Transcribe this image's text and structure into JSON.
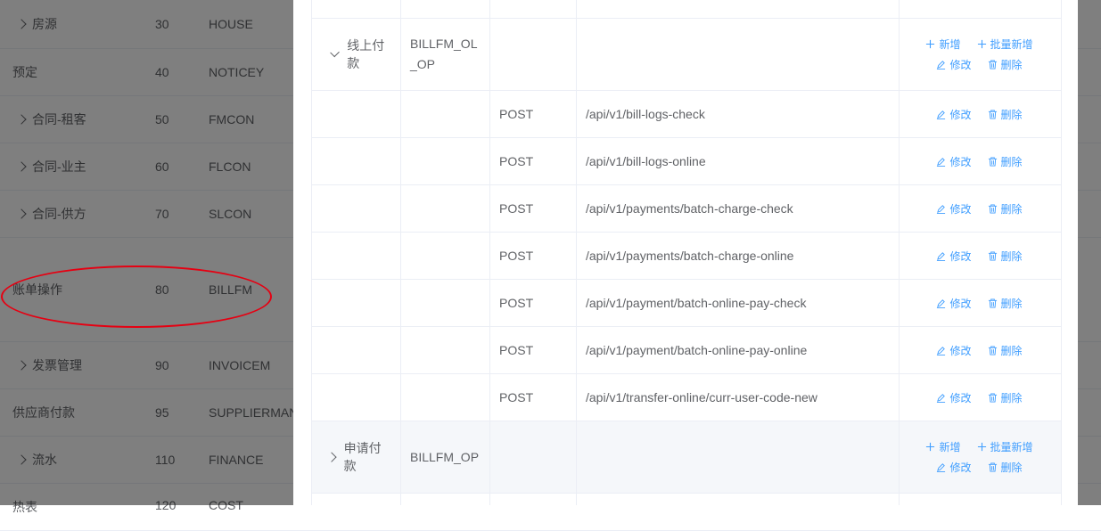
{
  "background_table": {
    "rows": [
      {
        "name": "房源",
        "code": "30",
        "key": "HOUSE",
        "expandable": true
      },
      {
        "name": "预定",
        "code": "40",
        "key": "NOTICEY",
        "expandable": false
      },
      {
        "name": "合同-租客",
        "code": "50",
        "key": "FMCON",
        "expandable": true
      },
      {
        "name": "合同-业主",
        "code": "60",
        "key": "FLCON",
        "expandable": true
      },
      {
        "name": "合同-供方",
        "code": "70",
        "key": "SLCON",
        "expandable": true
      },
      {
        "name": "账单操作",
        "code": "80",
        "key": "BILLFM",
        "expandable": false
      },
      {
        "name": "发票管理",
        "code": "90",
        "key": "INVOICEM",
        "expandable": true
      },
      {
        "name": "供应商付款",
        "code": "95",
        "key": "SUPPLIERMAN",
        "expandable": false
      },
      {
        "name": "流水",
        "code": "110",
        "key": "FINANCE",
        "expandable": true
      },
      {
        "name": "热表",
        "code": "120",
        "key": "COST",
        "expandable": false
      }
    ]
  },
  "dialog_table": {
    "actions": {
      "add": "新增",
      "batch_add": "批量新增",
      "edit": "修改",
      "delete": "删除"
    },
    "group_online": {
      "name": "线上付款",
      "code": "BILLFM_OL_OP"
    },
    "rows": [
      {
        "method": "POST",
        "path": "/api/v1/bill-logs-check"
      },
      {
        "method": "POST",
        "path": "/api/v1/bill-logs-online"
      },
      {
        "method": "POST",
        "path": "/api/v1/payments/batch-charge-check"
      },
      {
        "method": "POST",
        "path": "/api/v1/payments/batch-charge-online"
      },
      {
        "method": "POST",
        "path": "/api/v1/payment/batch-online-pay-check"
      },
      {
        "method": "POST",
        "path": "/api/v1/payment/batch-online-pay-online"
      },
      {
        "method": "POST",
        "path": "/api/v1/transfer-online/curr-user-code-new"
      }
    ],
    "group_apply": {
      "name": "申请付款",
      "code": "BILLFM_OP"
    }
  },
  "colors": {
    "link": "#409eff",
    "annotation": "#e60012",
    "highlight_row": "#f5f7fa"
  }
}
